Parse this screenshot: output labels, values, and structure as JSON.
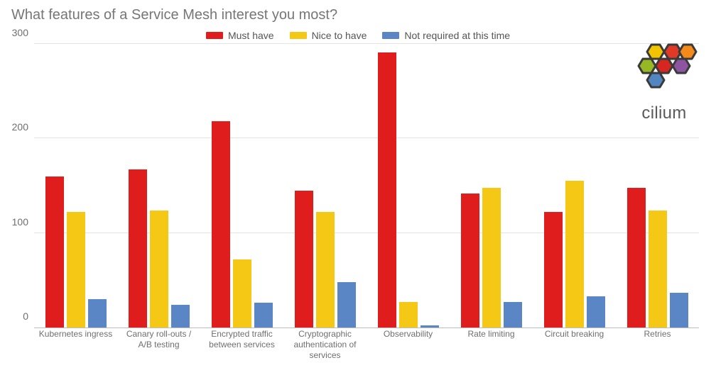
{
  "chart_data": {
    "type": "bar",
    "title": "What features of a Service Mesh interest you most?",
    "xlabel": "",
    "ylabel": "",
    "ylim": [
      0,
      300
    ],
    "yticks": [
      0,
      100,
      200,
      300
    ],
    "categories": [
      "Kubernetes ingress",
      "Canary roll-outs / A/B testing",
      "Encrypted traffic between services",
      "Cryptographic authentication of services",
      "Observability",
      "Rate limiting",
      "Circuit breaking",
      "Retries"
    ],
    "legend_position": "top",
    "series": [
      {
        "name": "Must have",
        "color": "#df1d1d",
        "values": [
          160,
          167,
          218,
          145,
          291,
          142,
          122,
          148
        ]
      },
      {
        "name": "Nice to have",
        "color": "#f5c816",
        "values": [
          122,
          124,
          72,
          122,
          27,
          148,
          155,
          124
        ]
      },
      {
        "name": "Not required at this time",
        "color": "#5a86c5",
        "values": [
          30,
          24,
          26,
          48,
          2,
          27,
          33,
          37
        ]
      }
    ]
  },
  "logo": {
    "text": "cilium",
    "hex_colors": [
      "#f2c400",
      "#e03a26",
      "#f48a1a",
      "#95b824",
      "#d6261f",
      "#8c54a1",
      "#5186c0"
    ]
  }
}
